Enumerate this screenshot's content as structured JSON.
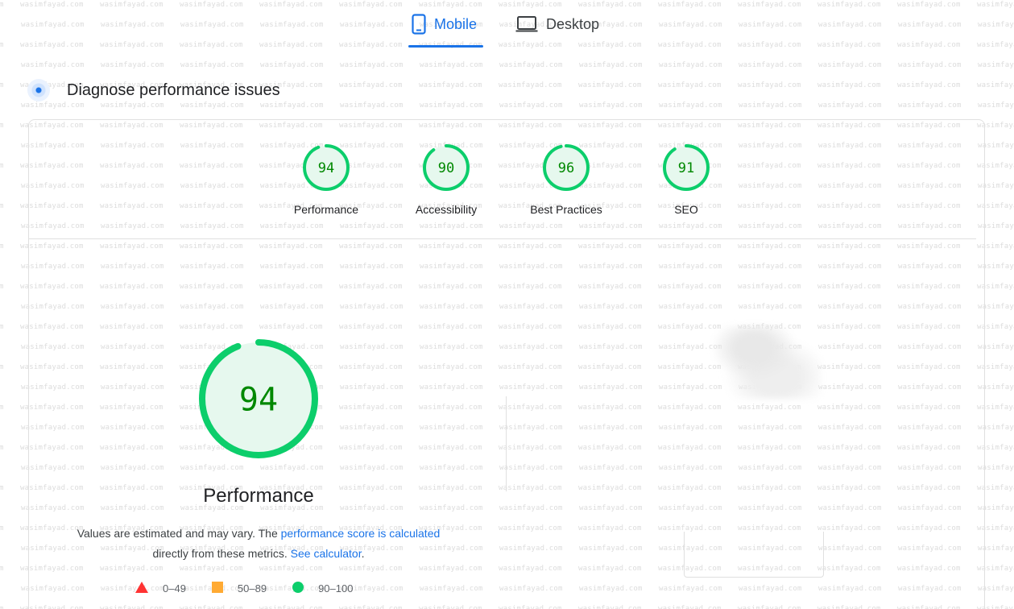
{
  "watermark": "wasimfayad.com",
  "tabs": [
    {
      "label": "Mobile",
      "icon": "smartphone-icon",
      "selected": true
    },
    {
      "label": "Desktop",
      "icon": "laptop-icon",
      "selected": false
    }
  ],
  "heading": {
    "title": "Diagnose performance issues",
    "icon": "pulse-dot-icon"
  },
  "scores": [
    {
      "label": "Performance",
      "value": 94
    },
    {
      "label": "Accessibility",
      "value": 90
    },
    {
      "label": "Best Practices",
      "value": 96
    },
    {
      "label": "SEO",
      "value": 91
    }
  ],
  "main_score": {
    "label": "Performance",
    "value": 94
  },
  "note": {
    "text_1": "Values are estimated and may vary. The ",
    "link_1": "performance score is calculated",
    "text_2": "directly from these metrics. ",
    "link_2": "See calculator",
    "text_3": "."
  },
  "legend": [
    {
      "range": "0–49",
      "shape": "triangle",
      "color": "#ff3333"
    },
    {
      "range": "50–89",
      "shape": "square",
      "color": "#ffaa33"
    },
    {
      "range": "90–100",
      "shape": "circle",
      "color": "#0cce6b"
    }
  ],
  "colors": {
    "accent": "#1a73e8",
    "pass": "#0cce6b",
    "pass_text": "#008800",
    "pass_fill": "#e6f8ee"
  }
}
